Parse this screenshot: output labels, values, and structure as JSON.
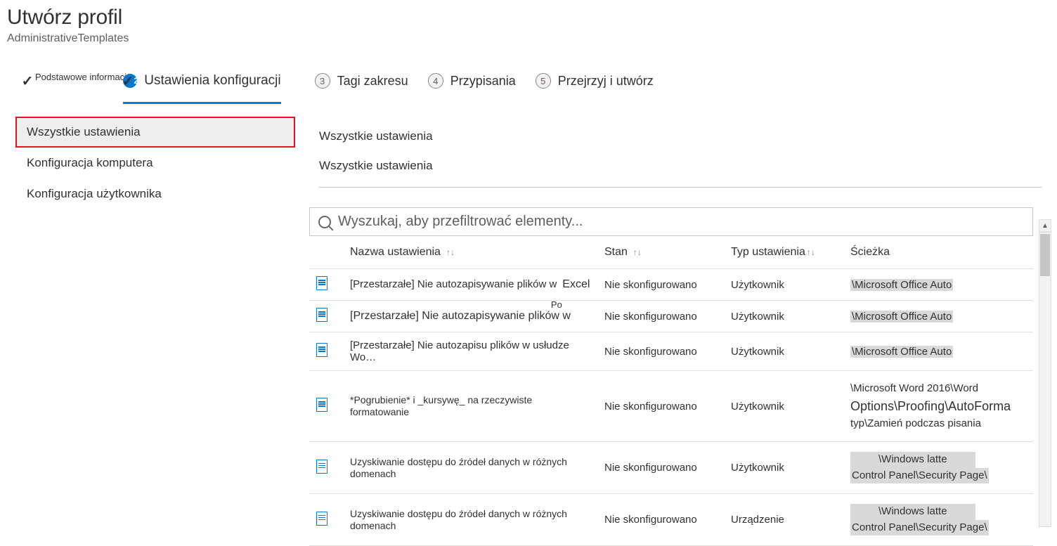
{
  "header": {
    "title": "Utwórz profil",
    "subtitle": "AdministrativeTemplates"
  },
  "stepper": {
    "step1_label": "Podstawowe informacje",
    "step2_num": "2",
    "step2_label": "Ustawienia konfiguracji",
    "step3_num": "3",
    "step3_label": "Tagi zakresu",
    "step4_num": "4",
    "step4_label": "Przypisania",
    "step5_num": "5",
    "step5_label": "Przejrzyj i utwórz"
  },
  "sidebar": {
    "items": {
      "0": {
        "label": "Wszystkie ustawienia"
      },
      "1": {
        "label": "Konfiguracja komputera"
      },
      "2": {
        "label": "Konfiguracja użytkownika"
      }
    }
  },
  "breadcrumb": {
    "line1": "Wszystkie ustawienia",
    "line2": "Wszystkie ustawienia"
  },
  "search": {
    "placeholder": "Wyszukaj, aby przefiltrować elementy..."
  },
  "columns": {
    "name": "Nazwa ustawienia",
    "state": "Stan",
    "type": "Typ ustawienia",
    "path": "Ścieżka",
    "sort": "↑↓"
  },
  "rows": [
    {
      "name": "[Przestarzałe] Nie autozapisywanie plików w",
      "extra": "Excel",
      "state": "Nie skonfigurowano",
      "type": "Użytkownik",
      "path1": "\\Microsoft Office Auto"
    },
    {
      "name": "[Przestarzałe] Nie autozapisywanie plików w",
      "po": "Po",
      "state": "Nie skonfigurowano",
      "type": "Użytkownik",
      "path1": "\\Microsoft Office Auto"
    },
    {
      "name": "[Przestarzałe] Nie autozapisu plików w usłudze Wo…",
      "state": "Nie skonfigurowano",
      "type": "Użytkownik",
      "path1": "\\Microsoft Office Auto"
    },
    {
      "name": "*Pogrubienie* i _kursywę_ na rzeczywiste formatowanie",
      "state": "Nie skonfigurowano",
      "type": "Użytkownik",
      "path1": "\\Microsoft Word 2016\\Word",
      "path2": "Options\\Proofing\\AutoForma",
      "path3": "typ\\Zamień podczas pisania"
    },
    {
      "name": "Uzyskiwanie dostępu do źródeł danych w różnych domenach",
      "state": "Nie skonfigurowano",
      "type": "Użytkownik",
      "path1": "\\Windows latte",
      "path2": "Control Panel\\Security Page\\"
    },
    {
      "name": "Uzyskiwanie dostępu do źródeł danych w różnych domenach",
      "state": "Nie skonfigurowano",
      "type": "Urządzenie",
      "path1": "\\Windows latte",
      "path2": "Control Panel\\Security Page\\"
    }
  ]
}
